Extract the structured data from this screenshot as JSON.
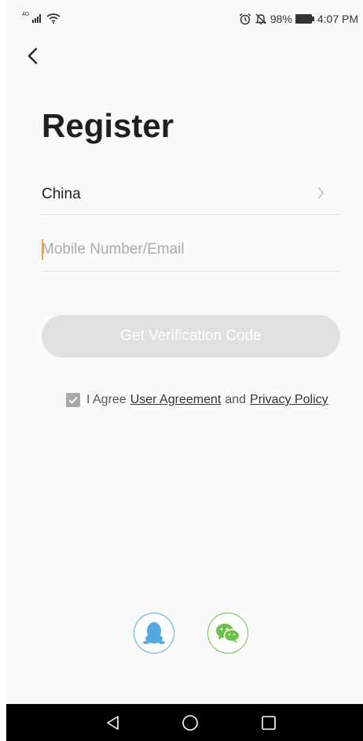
{
  "status_bar": {
    "network": "4G",
    "battery": "98%",
    "time": "4:07 PM",
    "icons": [
      "signal-icon",
      "wifi-icon",
      "alarm-icon",
      "mute-icon",
      "battery-icon"
    ]
  },
  "header": {
    "back_icon": "chevron-left-icon"
  },
  "page": {
    "title": "Register"
  },
  "form": {
    "country": "China",
    "account_value": "",
    "account_placeholder": "Mobile Number/Email",
    "verify_label": "Get Verification Code"
  },
  "agreement": {
    "checked": true,
    "prefix": "I Agree",
    "user_agreement": "User Agreement",
    "conjunction": "and",
    "privacy_policy": "Privacy Policy"
  },
  "social_login": {
    "items": [
      {
        "icon": "qq-icon",
        "color": "#55a9e0"
      },
      {
        "icon": "wechat-icon",
        "color": "#6cc04a"
      }
    ]
  },
  "nav_bar": {
    "icons": [
      "nav-back-icon",
      "nav-home-icon",
      "nav-recent-icon"
    ]
  },
  "colors": {
    "accent_caret": "#f0a03c",
    "button_disabled": "#e0e0e0",
    "title": "#1f1f1f"
  }
}
